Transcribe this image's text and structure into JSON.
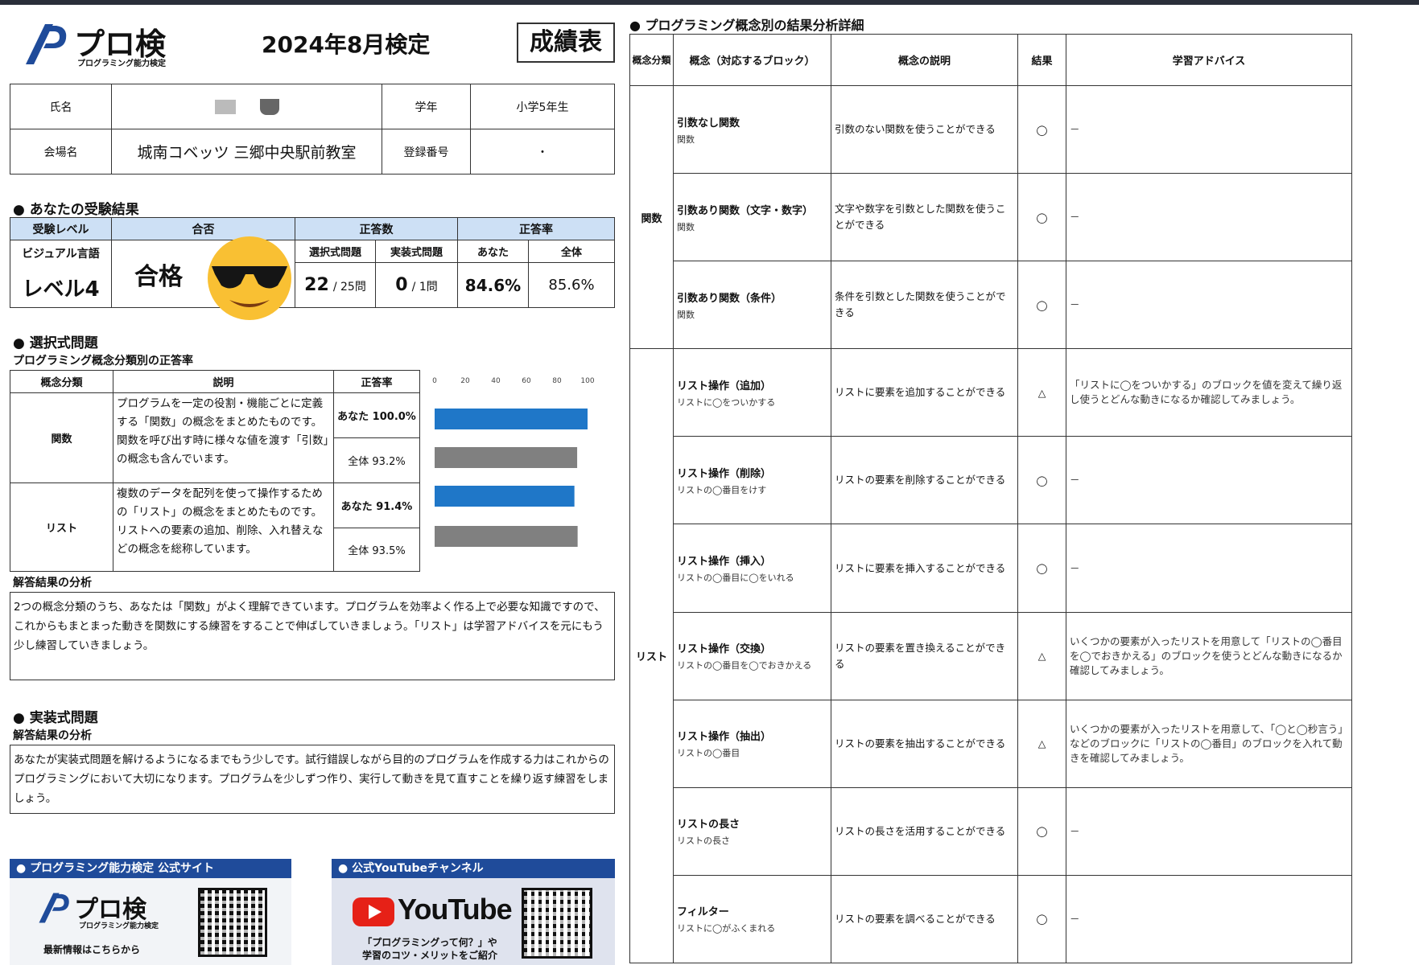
{
  "header": {
    "logo_text": "プロ検",
    "logo_sub": "プログラミング能力検定",
    "exam_title": "2024年8月検定",
    "report_title": "成績表"
  },
  "info": {
    "name_label": "氏名",
    "grade_label": "学年",
    "grade_value": "小学5年生",
    "venue_label": "会場名",
    "venue_value": "城南コベッツ 三郷中央駅前教室",
    "reg_label": "登録番号",
    "reg_value": "・"
  },
  "results": {
    "heading": "● あなたの受験結果",
    "h_level": "受験レベル",
    "h_pass": "合否",
    "h_count": "正答数",
    "h_rate": "正答率",
    "language": "ビジュアル言語",
    "level": "レベル4",
    "pass": "合格",
    "choice_label": "選択式問題",
    "impl_label": "実装式問題",
    "you_label": "あなた",
    "overall_label": "全体",
    "choice_score": "22",
    "choice_total": "/ 25問",
    "impl_score": "0",
    "impl_total": "/ 1問",
    "your_rate": "84.6%",
    "overall_rate": "85.6%"
  },
  "choice": {
    "heading": "● 選択式問題",
    "subheading": "プログラミング概念分類別の正答率",
    "h_concept": "概念分類",
    "h_desc": "説明",
    "h_rate": "正答率",
    "rows": [
      {
        "concept": "関数",
        "desc": "プログラムを一定の役割・機能ごとに定義する「関数」の概念をまとめたものです。関数を呼び出す時に様々な値を渡す「引数」の概念も含んでいます。",
        "you": "あなた 100.0%",
        "all": "全体 93.2%"
      },
      {
        "concept": "リスト",
        "desc": "複数のデータを配列を使って操作するための「リスト」の概念をまとめたものです。リストへの要素の追加、削除、入れ替えなどの概念を総称しています。",
        "you": "あなた 91.4%",
        "all": "全体 93.5%"
      }
    ],
    "analysis_heading": "解答結果の分析",
    "analysis": "2つの概念分類のうち、あなたは「関数」がよく理解できています。プログラムを効率よく作る上で必要な知識ですので、これからもまとまった動きを関数にする練習をすることで伸ばしていきましょう。「リスト」は学習アドバイスを元にもう少し練習していきましょう。"
  },
  "chart_data": {
    "type": "bar",
    "orientation": "horizontal",
    "x_ticks": [
      "0",
      "20",
      "40",
      "60",
      "80",
      "100"
    ],
    "xlim": [
      0,
      100
    ],
    "bars": [
      {
        "value": 100.0,
        "color": "#1f77c8"
      },
      {
        "value": 93.2,
        "color": "#808080"
      },
      {
        "value": 91.4,
        "color": "#1f77c8"
      },
      {
        "value": 93.5,
        "color": "#808080"
      }
    ]
  },
  "impl": {
    "heading": "● 実装式問題",
    "analysis_heading": "解答結果の分析",
    "analysis": "あなたが実装式問題を解けるようになるまでもう少しです。試行錯誤しながら目的のプログラムを作成する力はこれからのプログラミングにおいて大切になります。プログラムを少しずつ作り、実行して動きを見て直すことを繰り返す練習をしましょう。"
  },
  "footer": {
    "site_title": "● プログラミング能力検定 公式サイト",
    "site_caption": "最新情報はこちらから",
    "yt_title": "● 公式YouTubeチャンネル",
    "yt_word": "YouTube",
    "yt_caption": "「プログラミングって何？」や\n学習のコツ・メリットをご紹介"
  },
  "detail": {
    "heading": "● プログラミング概念別の結果分析詳細",
    "h_category": "概念分類",
    "h_concept": "概念（対応するブロック）",
    "h_desc": "概念の説明",
    "h_result": "結果",
    "h_advice": "学習アドバイス",
    "groups": [
      {
        "category": "関数",
        "rows": [
          {
            "name": "引数なし関数",
            "block": "関数",
            "desc": "引数のない関数を使うことができる",
            "result": "◯",
            "advice": "－"
          },
          {
            "name": "引数あり関数（文字・数字）",
            "block": "関数",
            "desc": "文字や数字を引数とした関数を使うことができる",
            "result": "◯",
            "advice": "－"
          },
          {
            "name": "引数あり関数（条件）",
            "block": "関数",
            "desc": "条件を引数とした関数を使うことができる",
            "result": "◯",
            "advice": "－"
          }
        ]
      },
      {
        "category": "リスト",
        "rows": [
          {
            "name": "リスト操作（追加）",
            "block": "リストに◯をついかする",
            "desc": "リストに要素を追加することができる",
            "result": "△",
            "advice": "「リストに◯をついかする」のブロックを値を変えて繰り返し使うとどんな動きになるか確認してみましょう。"
          },
          {
            "name": "リスト操作（削除）",
            "block": "リストの◯番目をけす",
            "desc": "リストの要素を削除することができる",
            "result": "◯",
            "advice": "－"
          },
          {
            "name": "リスト操作（挿入）",
            "block": "リストの◯番目に◯をいれる",
            "desc": "リストに要素を挿入することができる",
            "result": "◯",
            "advice": "－"
          },
          {
            "name": "リスト操作（交換）",
            "block": "リストの◯番目を◯でおきかえる",
            "desc": "リストの要素を置き換えることができる",
            "result": "△",
            "advice": "いくつかの要素が入ったリストを用意して「リストの◯番目を◯でおきかえる」のブロックを使うとどんな動きになるか確認してみましょう。"
          },
          {
            "name": "リスト操作（抽出）",
            "block": "リストの◯番目",
            "desc": "リストの要素を抽出することができる",
            "result": "△",
            "advice": "いくつかの要素が入ったリストを用意して、「◯と◯秒言う」などのブロックに「リストの◯番目」のブロックを入れて動きを確認してみましょう。"
          },
          {
            "name": "リストの長さ",
            "block": "リストの長さ",
            "desc": "リストの長さを活用することができる",
            "result": "◯",
            "advice": "－"
          },
          {
            "name": "フィルター",
            "block": "リストに◯がふくまれる",
            "desc": "リストの要素を調べることができる",
            "result": "◯",
            "advice": "－"
          }
        ]
      }
    ]
  }
}
